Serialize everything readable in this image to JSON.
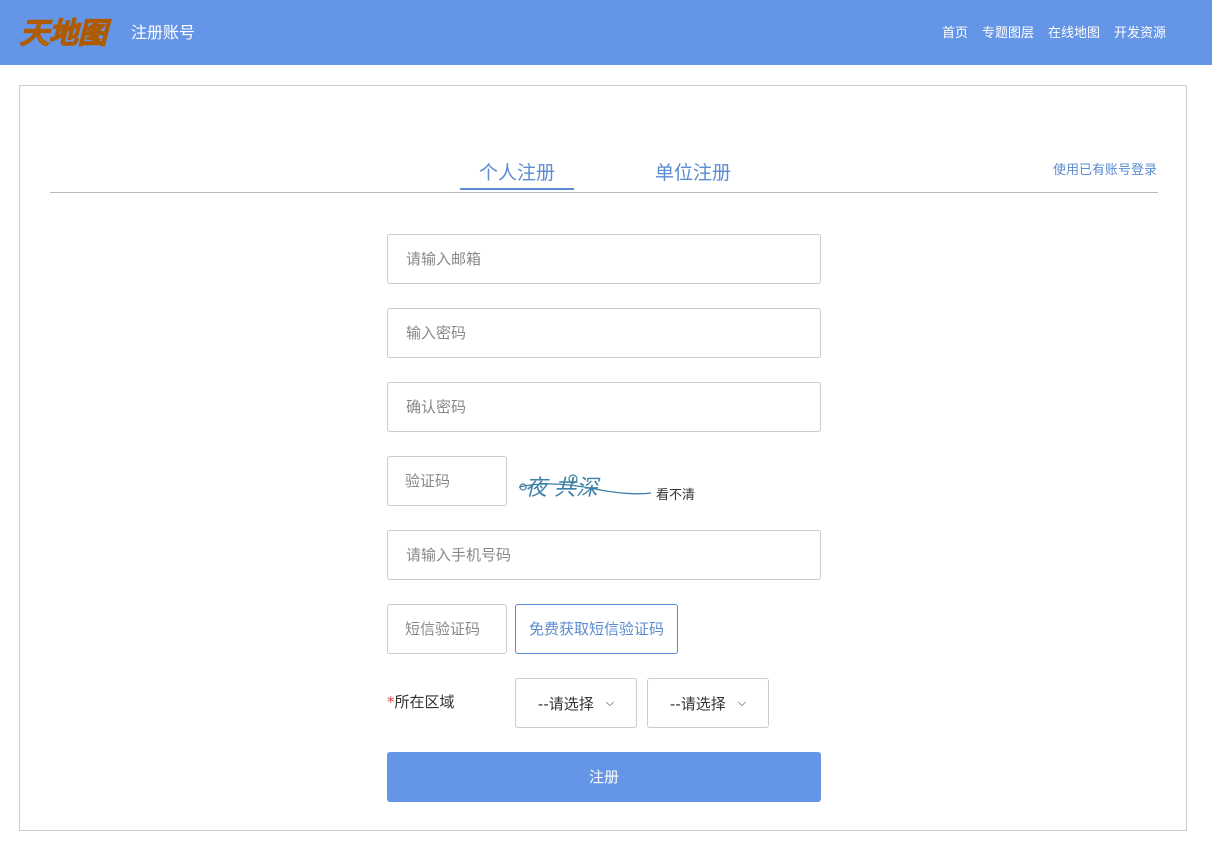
{
  "header": {
    "logo_text": "天地图",
    "page_title": "注册账号",
    "nav": [
      "首页",
      "专题图层",
      "在线地图",
      "开发资源"
    ]
  },
  "tabs": [
    {
      "label": "个人注册",
      "active": true
    },
    {
      "label": "单位注册",
      "active": false
    }
  ],
  "login_link": "使用已有账号登录",
  "form": {
    "email_placeholder": "请输入邮箱",
    "password_placeholder": "输入密码",
    "confirm_placeholder": "确认密码",
    "captcha_placeholder": "验证码",
    "captcha_text": "夜 共深",
    "captcha_refresh": "看不清",
    "phone_placeholder": "请输入手机号码",
    "sms_placeholder": "短信验证码",
    "sms_button": "免费获取短信验证码",
    "region_required_mark": "*",
    "region_label": "所在区域",
    "province_select": "--请选择",
    "city_select": "--请选择",
    "submit": "注册"
  },
  "colors": {
    "brand": "#6495e6",
    "link": "#5b8bd0",
    "required": "#e23b3b"
  }
}
